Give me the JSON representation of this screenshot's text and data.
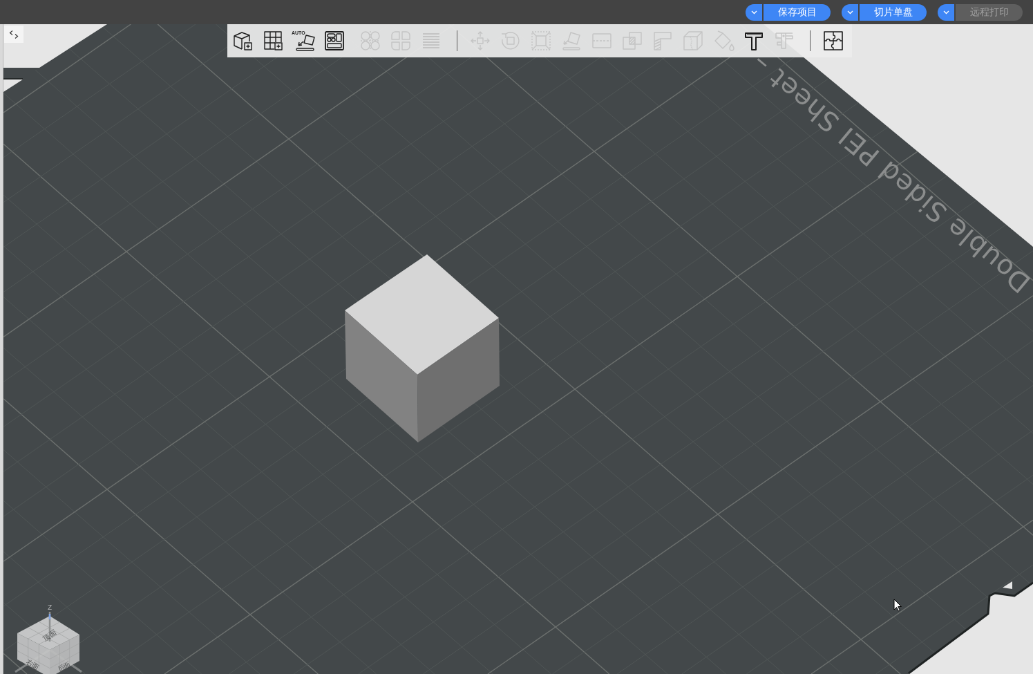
{
  "top_bar": {
    "actions": [
      {
        "label": "保存项目",
        "disabled": false
      },
      {
        "label": "切片单盘",
        "disabled": false
      },
      {
        "label": "远程打印",
        "disabled": true
      }
    ]
  },
  "toolbar": {
    "groups": [
      [
        {
          "disabled": false
        },
        {
          "disabled": false
        },
        {
          "disabled": false,
          "badge": "AUTO"
        },
        {
          "disabled": false
        },
        {
          "disabled": true
        },
        {
          "disabled": true
        },
        {
          "disabled": true
        }
      ],
      [
        {
          "disabled": true
        },
        {
          "disabled": true
        },
        {
          "disabled": true
        },
        {
          "disabled": true
        },
        {
          "disabled": true
        },
        {
          "disabled": true
        },
        {
          "disabled": true
        },
        {
          "disabled": true
        },
        {
          "disabled": true
        },
        {
          "disabled": false
        },
        {
          "disabled": true
        }
      ],
      [
        {
          "disabled": false
        }
      ]
    ]
  },
  "viewport": {
    "plate_label": "Double Sided PEI Sheet –",
    "view_cube": {
      "axis_label": "Z",
      "faces": [
        "顶面",
        "右面",
        "后面"
      ]
    }
  }
}
